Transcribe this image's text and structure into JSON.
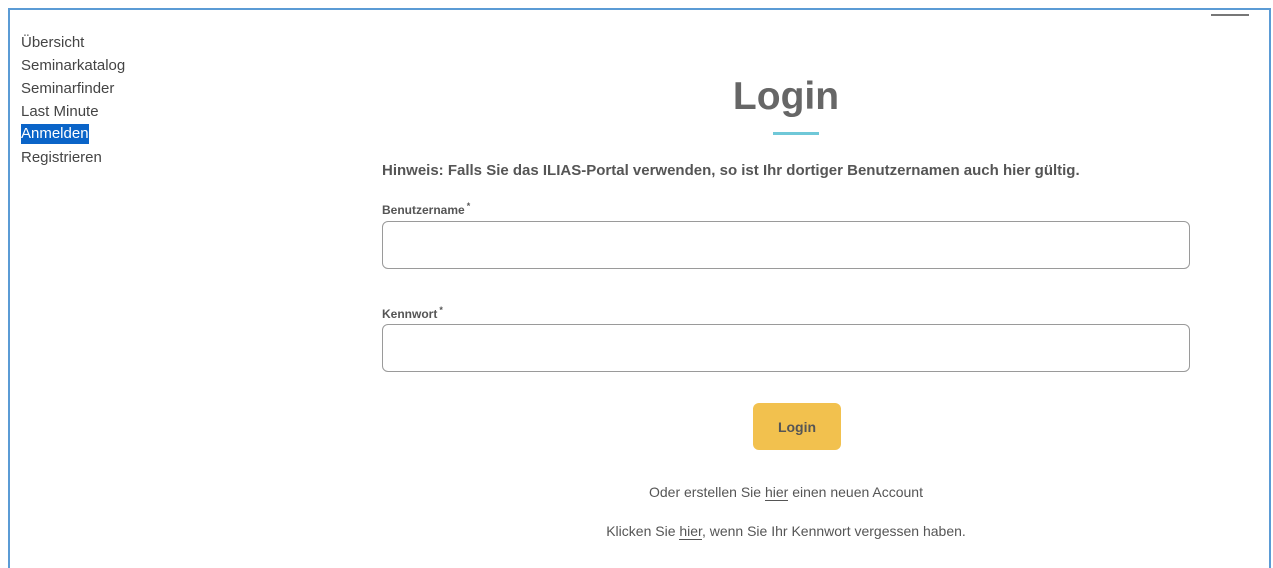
{
  "sidebar": {
    "items": [
      {
        "label": "Übersicht"
      },
      {
        "label": "Seminarkatalog"
      },
      {
        "label": "Seminarfinder"
      },
      {
        "label": "Last Minute"
      },
      {
        "label": "Anmelden"
      },
      {
        "label": "Registrieren"
      }
    ]
  },
  "main": {
    "title": "Login",
    "hint": "Hinweis: Falls Sie das ILIAS-Portal verwenden, so ist Ihr dortiger Benutzernamen auch hier gültig.",
    "username_label": "Benutzername",
    "password_label": "Kennwort",
    "required_mark": "*",
    "username_value": "",
    "password_value": "",
    "login_button": "Login",
    "create_prefix": "Oder erstellen Sie ",
    "create_link": "hier",
    "create_suffix": " einen neuen Account",
    "forgot_prefix": "Klicken Sie ",
    "forgot_link": "hier",
    "forgot_suffix": ", wenn Sie Ihr Kennwort vergessen haben."
  },
  "colors": {
    "accent_button": "#f2c14e",
    "title_underline": "#6fc8d8",
    "active_nav": "#0a64c8",
    "frame_border": "#5b9bd5"
  }
}
